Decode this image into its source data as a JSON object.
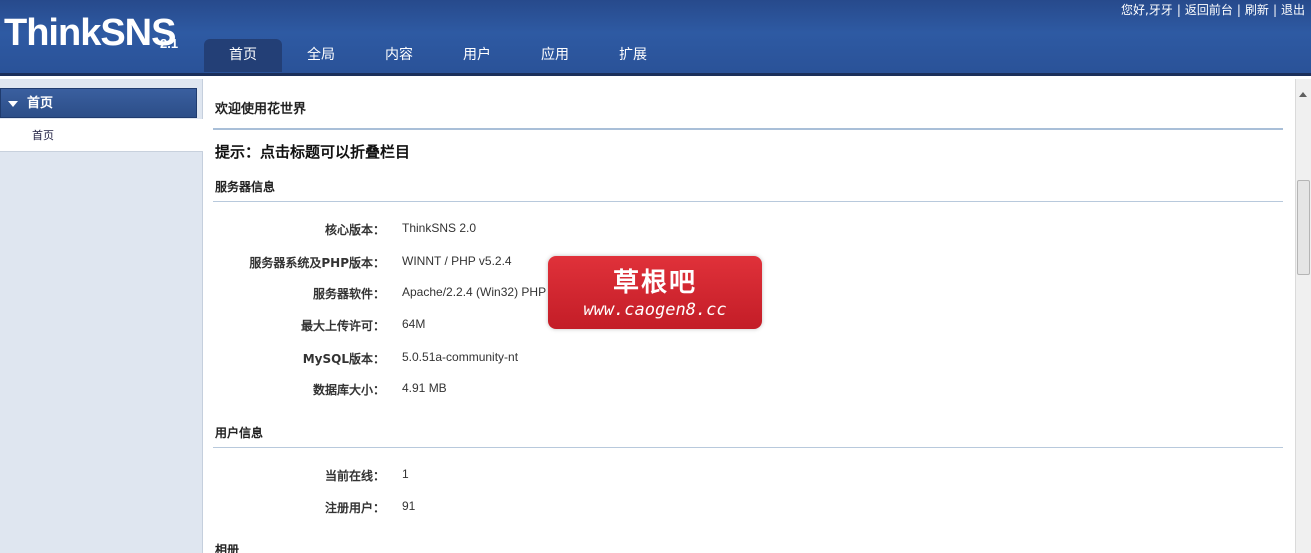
{
  "app": {
    "logo": "ThinkSNS",
    "version": "2.1"
  },
  "toplinks": {
    "greeting": "您好,牙牙",
    "sep": "|",
    "back": "返回前台",
    "refresh": "刷新",
    "logout": "退出"
  },
  "tabs": [
    {
      "label": "首页",
      "active": true
    },
    {
      "label": "全局"
    },
    {
      "label": "内容"
    },
    {
      "label": "用户"
    },
    {
      "label": "应用"
    },
    {
      "label": "扩展"
    }
  ],
  "sidebar": {
    "section": "首页",
    "items": [
      "首页"
    ]
  },
  "main": {
    "title": "欢迎使用花世界",
    "tip": "提示：点击标题可以折叠栏目",
    "server": {
      "title": "服务器信息",
      "rows": [
        {
          "k": "核心版本：",
          "v": "ThinkSNS 2.0"
        },
        {
          "k": "服务器系统及PHP版本：",
          "v": "WINNT / PHP v5.2.4"
        },
        {
          "k": "服务器软件：",
          "v": "Apache/2.2.4 (Win32) PHP"
        },
        {
          "k": "最大上传许可：",
          "v": "64M"
        },
        {
          "k": "MySQL版本：",
          "v": "5.0.51a-community-nt"
        },
        {
          "k": "数据库大小：",
          "v": "4.91 MB"
        }
      ]
    },
    "users": {
      "title": "用户信息",
      "rows": [
        {
          "k": "当前在线：",
          "v": "1"
        },
        {
          "k": "注册用户：",
          "v": "91"
        }
      ]
    },
    "album": {
      "title": "相册"
    }
  },
  "watermark": {
    "cn": "草根吧",
    "url": "www.caogen8.cc"
  },
  "colors": {
    "header": "#2e5aa3",
    "active_tab": "#233f76",
    "sidebar_bg": "#dfe6f0",
    "watermark": "#d42530"
  }
}
